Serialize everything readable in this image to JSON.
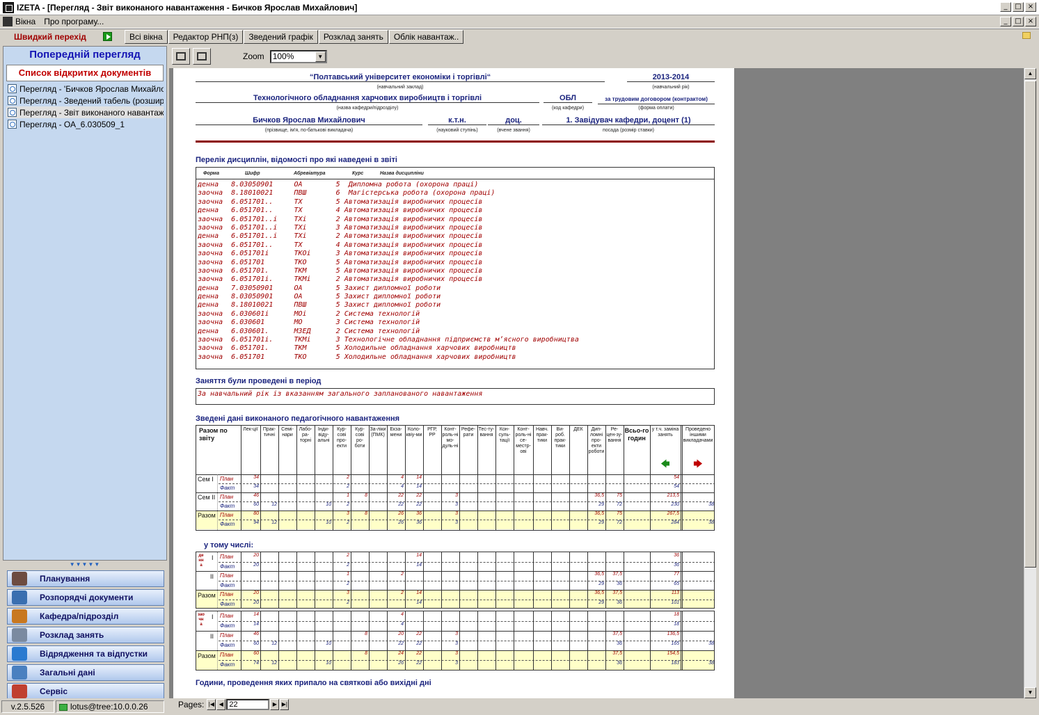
{
  "window": {
    "title": "IZETA - [Перегляд - Звіт виконаного навантаження - Бичков Ярослав Михайлович]",
    "min": "_",
    "max": "□",
    "close": "×"
  },
  "menu": {
    "items": [
      "Вікна",
      "Про програму..."
    ]
  },
  "toolbar": {
    "quick": "Швидкий перехід",
    "buttons": [
      "Всі вікна",
      "Редактор РНП(з)",
      "Зведений графік",
      "Розклад занять",
      "Облік навантаж.."
    ]
  },
  "sidebar": {
    "header": "Попередній перегляд",
    "subheader": "Список відкритих документів",
    "docs": [
      "Перегляд - 'Бичков Ярослав Михайло...",
      "Перегляд - Зведений табель (розшире...",
      "Перегляд - Звіт виконаного навантаж...",
      "Перегляд - ОА_6.030509_1"
    ],
    "nav": [
      {
        "label": "Планування",
        "color": "#6d4c41"
      },
      {
        "label": "Розпорядчі документи",
        "color": "#3a6fb0"
      },
      {
        "label": "Кафедра/підрозділ",
        "color": "#c87820"
      },
      {
        "label": "Розклад занять",
        "color": "#7a8aa0"
      },
      {
        "label": "Відрядження та відпустки",
        "color": "#2a7ad0"
      },
      {
        "label": "Загальні дані",
        "color": "#4a80c0"
      },
      {
        "label": "Сервіс",
        "color": "#c04030"
      }
    ],
    "grip": "▼▼▼▼▼"
  },
  "viewer": {
    "zoom_label": "Zoom",
    "zoom_value": "100%"
  },
  "report": {
    "university": "“Полтавський університет економіки і торгівлі“",
    "year": "2013-2014",
    "c_university": "(навчальний заклад)",
    "c_year": "(навчальний рік)",
    "department": "Технологічного обладнання харчових виробництв і торгівлі",
    "dept_code": "ОБЛ",
    "payment": "за трудовим договором (контрактом)",
    "c_department": "(назва кафедри/підрозділу)",
    "c_code": "(код кафедри)",
    "c_payment": "(форма оплати)",
    "teacher": "Бичков Ярослав Михайлович",
    "degree": "к.т.н.",
    "rank": "доц.",
    "position": "1. Завідувач кафедри, доцент (1)",
    "c_teacher": "(прізвище, ім'я, по-батькові викладача)",
    "c_degree": "(науковий ступінь)",
    "c_rank": "(вчене звання)",
    "c_position": "посада (розмір ставки)",
    "s_disciplines": "Перелік дисциплін, відомості про які наведені в звіті",
    "disc_headers": [
      "Форма",
      "Шифр",
      "Абревіатура",
      "Курс",
      "Назва дисципліни"
    ],
    "disciplines": [
      [
        "денна",
        "8.03050901",
        "ОА",
        "5",
        " Дипломна робота (охорона праці)"
      ],
      [
        "заочна",
        "8.18010021",
        "ПВШ",
        "6",
        " Магістерська робота (охорона праці)"
      ],
      [
        "заочна",
        "6.051701..",
        "ТХ",
        "5",
        "Автоматизація виробничих процесів"
      ],
      [
        "денна",
        "6.051701..",
        "ТХ",
        "4",
        "Автоматизація виробничих процесів"
      ],
      [
        "заочна",
        "6.051701..і",
        "ТХі",
        "2",
        "Автоматизація виробничих процесів"
      ],
      [
        "заочна",
        "6.051701..і",
        "ТХі",
        "3",
        "Автоматизація виробничих процесів"
      ],
      [
        "денна",
        "6.051701..і",
        "ТХі",
        "2",
        "Автоматизація виробничих процесів"
      ],
      [
        "заочна",
        "6.051701..",
        "ТХ",
        "4",
        "Автоматизація виробничих процесів"
      ],
      [
        "заочна",
        "6.051701і",
        "ТКОі",
        "3",
        "Автоматизація виробничих процесів"
      ],
      [
        "заочна",
        "6.051701",
        "ТКО",
        "5",
        "Автоматизація виробничих процесів"
      ],
      [
        "заочна",
        "6.051701.",
        "ТКМ",
        "5",
        "Автоматизація виробничих процесів"
      ],
      [
        "заочна",
        "6.051701і.",
        "ТКМі",
        "2",
        "Автоматизація виробничих процесів"
      ],
      [
        "денна",
        "7.03050901",
        "ОА",
        "5",
        "Захист дипломної роботи"
      ],
      [
        "денна",
        "8.03050901",
        "ОА",
        "5",
        "Захист дипломної роботи"
      ],
      [
        "денна",
        "8.18010021",
        "ПВШ",
        "5",
        "Захист дипломної роботи"
      ],
      [
        "заочна",
        "6.030601і",
        "МОі",
        "2",
        "Система технологій"
      ],
      [
        "заочна",
        "6.030601",
        "МО",
        "3",
        "Система технологій"
      ],
      [
        "денна",
        "6.030601.",
        "МЗЕД",
        "2",
        "Система технологій"
      ],
      [
        "заочна",
        "6.051701і.",
        "ТКМі",
        "3",
        "Технологічне обладнання підприємств м’ясного виробництва"
      ],
      [
        "заочна",
        "6.051701.",
        "ТКМ",
        "5",
        "Холодильне обладнання харчових виробництв"
      ],
      [
        "заочна",
        "6.051701",
        "ТКО",
        "5",
        "Холодильне обладнання харчових виробництв"
      ]
    ],
    "s_period": "Заняття були проведені в період",
    "period": "За навчальний рік із вказанням загального запланованого навантаження",
    "s_summary": "Зведені дані виконаного педагогічного навантаження",
    "col_headers": [
      "Лек-ції",
      "Прак-тичні",
      "Семі-нари",
      "Лабо-ра-торні",
      "Інди-віду-альні",
      "Кур-сові про-екти",
      "Кур-сові ро-боти",
      "За-ліки (ПМК)",
      "Екза-мени",
      "Коло-квіу-ми",
      "РГР, РР",
      "Конт-роль-ні мо-дуль-ні",
      "Рефе-рати",
      "Тес-ту-вання",
      "Кон-суль-тації",
      "Конт-роль-ні се-местр-ові",
      "Навч. прак-тики",
      "Ви-роб. прак-тики",
      "ДЕК",
      "Дип-ломні про-екти роботи",
      "Ре-цен-зу-вання"
    ],
    "razom_hdr": "Разом по звіту",
    "vsogo_hdr": "Всьо-го годин",
    "zamina_hdr": "у т.ч. заміна занять",
    "inshi_hdr": "Проведено іншими викладачами",
    "arrow_left": "🡄",
    "arrow_right": "🡆",
    "lbl_plan": "План",
    "lbl_fact": "Факт",
    "lbl_sem1": "Сем І",
    "lbl_sem2": "Сем ІІ",
    "lbl_razom": "Разом",
    "lbl_I": "І",
    "lbl_II": "ІІ",
    "s_including": "у тому числі:",
    "denna_v": "денна",
    "zaochna_v": "заочна",
    "summary": [
      {
        "plan": [
          [
            "0",
            "34"
          ],
          [
            "5",
            "2"
          ],
          [
            "8",
            "4"
          ],
          [
            "9",
            "14"
          ],
          [
            "22",
            "54"
          ]
        ],
        "fact": [
          [
            "0",
            "34"
          ],
          [
            "5",
            "2"
          ],
          [
            "8",
            "4"
          ],
          [
            "9",
            "14"
          ],
          [
            "22",
            "54"
          ]
        ]
      },
      {
        "plan": [
          [
            "0",
            "46"
          ],
          [
            "5",
            "1"
          ],
          [
            "6",
            "8"
          ],
          [
            "8",
            "22"
          ],
          [
            "9",
            "22"
          ],
          [
            "11",
            "3"
          ],
          [
            "19",
            "36,5"
          ],
          [
            "20",
            "75"
          ],
          [
            "22",
            "213,5"
          ]
        ],
        "fact": [
          [
            "0",
            "60"
          ],
          [
            "1",
            "12"
          ],
          [
            "4",
            "10"
          ],
          [
            "5",
            "2"
          ],
          [
            "8",
            "22"
          ],
          [
            "9",
            "22"
          ],
          [
            "11",
            "3"
          ],
          [
            "19",
            "29"
          ],
          [
            "20",
            "72"
          ],
          [
            "22",
            "230"
          ],
          [
            "23",
            "38"
          ]
        ]
      },
      {
        "plan": [
          [
            "0",
            "80"
          ],
          [
            "5",
            "3"
          ],
          [
            "6",
            "8"
          ],
          [
            "8",
            "26"
          ],
          [
            "9",
            "36"
          ],
          [
            "11",
            "3"
          ],
          [
            "19",
            "36,5"
          ],
          [
            "20",
            "75"
          ],
          [
            "22",
            "267,5"
          ]
        ],
        "fact": [
          [
            "0",
            "94"
          ],
          [
            "1",
            "12"
          ],
          [
            "4",
            "10"
          ],
          [
            "5",
            "2"
          ],
          [
            "8",
            "26"
          ],
          [
            "9",
            "36"
          ],
          [
            "11",
            "3"
          ],
          [
            "19",
            "29"
          ],
          [
            "20",
            "72"
          ],
          [
            "22",
            "284"
          ],
          [
            "23",
            "38"
          ]
        ]
      }
    ],
    "denna": [
      {
        "plan": [
          [
            "0",
            "20"
          ],
          [
            "5",
            "2"
          ],
          [
            "9",
            "14"
          ],
          [
            "22",
            "36"
          ]
        ],
        "fact": [
          [
            "0",
            "20"
          ],
          [
            "5",
            "2"
          ],
          [
            "9",
            "14"
          ],
          [
            "22",
            "36"
          ]
        ]
      },
      {
        "plan": [
          [
            "5",
            "1"
          ],
          [
            "8",
            "2"
          ],
          [
            "19",
            "36,5"
          ],
          [
            "20",
            "37,5"
          ],
          [
            "22",
            "77"
          ]
        ],
        "fact": [
          [
            "5",
            "2"
          ],
          [
            "19",
            "29"
          ],
          [
            "20",
            "36"
          ],
          [
            "22",
            "65"
          ]
        ]
      },
      {
        "plan": [
          [
            "0",
            "20"
          ],
          [
            "5",
            "3"
          ],
          [
            "8",
            "2"
          ],
          [
            "9",
            "14"
          ],
          [
            "19",
            "36,5"
          ],
          [
            "20",
            "37,5"
          ],
          [
            "22",
            "113"
          ]
        ],
        "fact": [
          [
            "0",
            "20"
          ],
          [
            "5",
            "2"
          ],
          [
            "9",
            "14"
          ],
          [
            "19",
            "29"
          ],
          [
            "20",
            "36"
          ],
          [
            "22",
            "101"
          ]
        ]
      }
    ],
    "zaochna": [
      {
        "plan": [
          [
            "0",
            "14"
          ],
          [
            "8",
            "4"
          ],
          [
            "22",
            "18"
          ]
        ],
        "fact": [
          [
            "0",
            "14"
          ],
          [
            "8",
            "4"
          ],
          [
            "22",
            "18"
          ]
        ]
      },
      {
        "plan": [
          [
            "0",
            "46"
          ],
          [
            "6",
            "8"
          ],
          [
            "8",
            "20"
          ],
          [
            "9",
            "22"
          ],
          [
            "11",
            "3"
          ],
          [
            "20",
            "37,5"
          ],
          [
            "22",
            "136,5"
          ]
        ],
        "fact": [
          [
            "0",
            "60"
          ],
          [
            "1",
            "12"
          ],
          [
            "4",
            "10"
          ],
          [
            "8",
            "22"
          ],
          [
            "9",
            "22"
          ],
          [
            "11",
            "3"
          ],
          [
            "20",
            "36"
          ],
          [
            "22",
            "165"
          ],
          [
            "23",
            "38"
          ]
        ]
      },
      {
        "plan": [
          [
            "0",
            "60"
          ],
          [
            "6",
            "8"
          ],
          [
            "8",
            "24"
          ],
          [
            "9",
            "22"
          ],
          [
            "11",
            "3"
          ],
          [
            "20",
            "37,5"
          ],
          [
            "22",
            "154,5"
          ]
        ],
        "fact": [
          [
            "0",
            "74"
          ],
          [
            "1",
            "12"
          ],
          [
            "4",
            "10"
          ],
          [
            "8",
            "26"
          ],
          [
            "9",
            "22"
          ],
          [
            "11",
            "3"
          ],
          [
            "20",
            "36"
          ],
          [
            "22",
            "183"
          ],
          [
            "23",
            "38"
          ]
        ]
      }
    ],
    "s_holidays": "Години, проведення яких припало на святкові або вихідні дні"
  },
  "statusbar": {
    "version": "v.2.5.526",
    "user": "lotus@tree:10.0.0.26",
    "pages_label": "Pages:",
    "page_value": "22"
  }
}
